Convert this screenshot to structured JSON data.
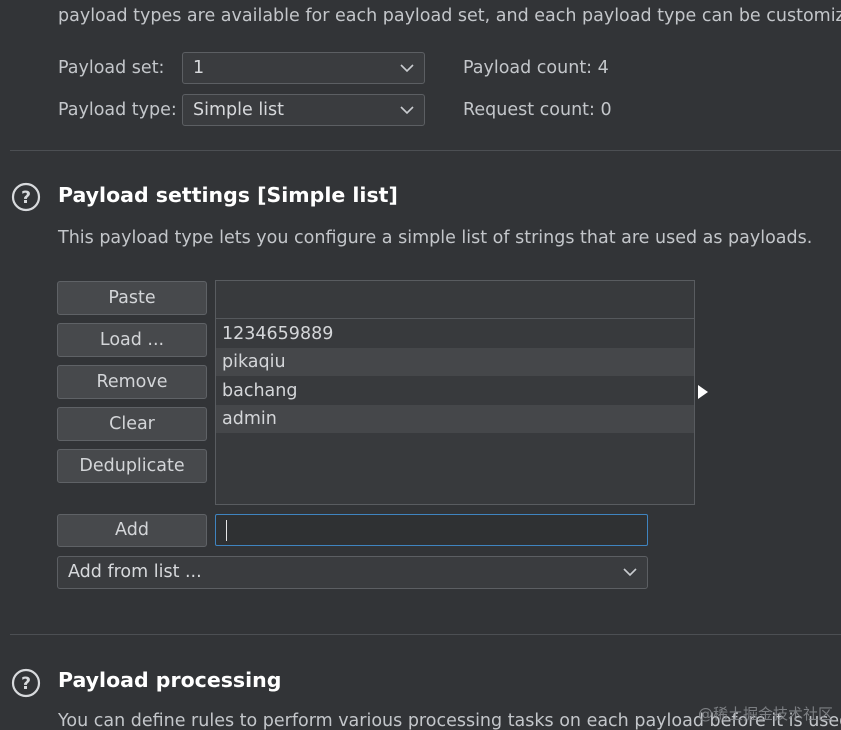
{
  "intro_text": "payload types are available for each payload set, and each payload type can be customized",
  "payload_set": {
    "label": "Payload set:",
    "value": "1"
  },
  "payload_type": {
    "label": "Payload type:",
    "value": "Simple list"
  },
  "payload_count": {
    "label": "Payload count:",
    "value": "4"
  },
  "request_count": {
    "label": "Request count:",
    "value": "0"
  },
  "payload_settings": {
    "title": "Payload settings [Simple list]",
    "description": "This payload type lets you configure a simple list of strings that are used as payloads.",
    "buttons": {
      "paste": "Paste",
      "load": "Load ...",
      "remove": "Remove",
      "clear": "Clear",
      "deduplicate": "Deduplicate",
      "add": "Add"
    },
    "list_items": [
      "1234659889",
      "pikaqiu",
      "bachang",
      "admin"
    ],
    "add_input_value": "",
    "add_from_list": "Add from list ..."
  },
  "payload_processing": {
    "title": "Payload processing",
    "description": "You can define rules to perform various processing tasks on each payload before it is used."
  },
  "watermark": "@稀土掘金技术社区",
  "icons": {
    "help": "help-icon",
    "chevron": "chevron-down-icon",
    "expand": "expand-arrow-icon"
  },
  "colors": {
    "background": "#323437",
    "heading": "#ffffff",
    "focus_border": "#3f84c0"
  }
}
